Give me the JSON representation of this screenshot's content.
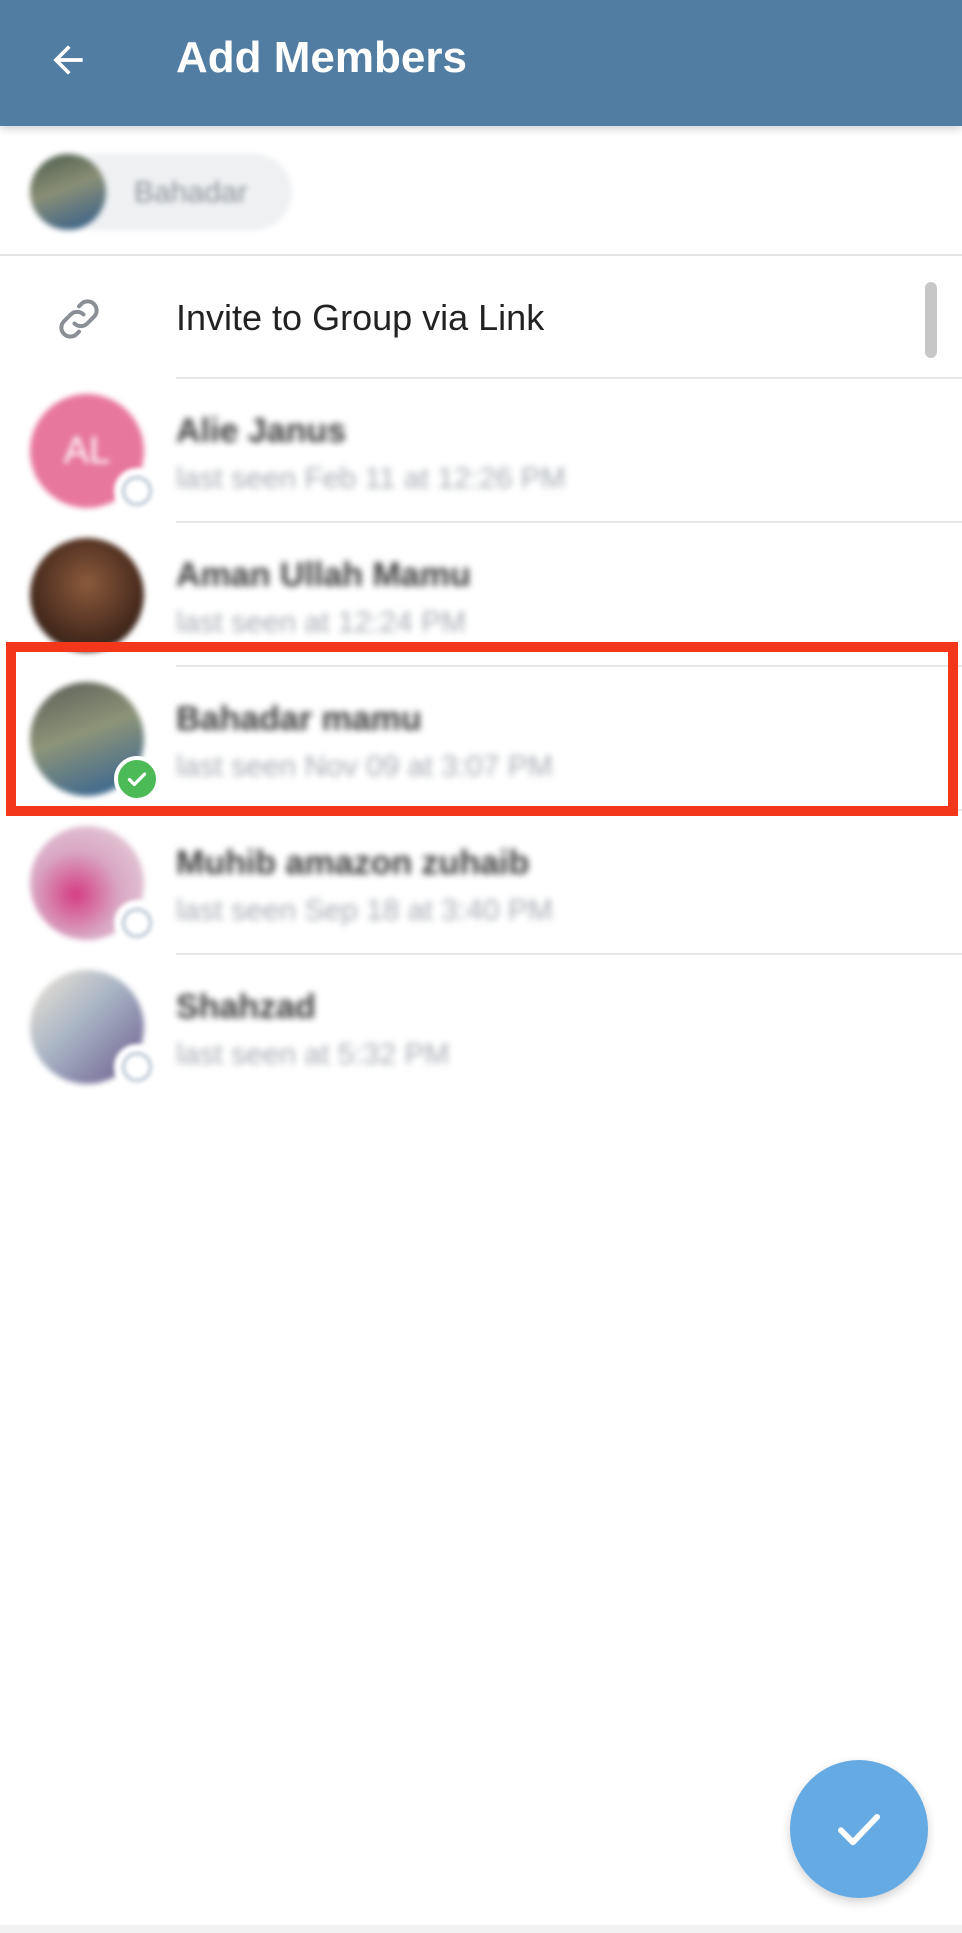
{
  "header": {
    "title": "Add Members",
    "back_icon": "arrow-back-icon",
    "background_color": "#517da2"
  },
  "chips": [
    {
      "label": "Bahadar"
    }
  ],
  "invite": {
    "label": "Invite to Group via Link",
    "icon": "link-icon"
  },
  "contacts": [
    {
      "name": "Alie Janus",
      "status": "last seen Feb 11 at 12:26 PM",
      "initials": "AL",
      "selected": false
    },
    {
      "name": "Aman Ullah Mamu",
      "status": "last seen at 12:24 PM",
      "initials": "",
      "selected": false
    },
    {
      "name": "Bahadar mamu",
      "status": "last seen Nov 09 at 3:07 PM",
      "initials": "",
      "selected": true
    },
    {
      "name": "Muhib amazon zuhaib",
      "status": "last seen Sep 18 at 3:40 PM",
      "initials": "",
      "selected": false
    },
    {
      "name": "Shahzad",
      "status": "last seen at 5:32 PM",
      "initials": "",
      "selected": false
    }
  ],
  "fab": {
    "icon": "check-icon",
    "color": "#65aae3"
  },
  "colors": {
    "selected_badge": "#4cbb57",
    "highlight_box": "#f2371a"
  }
}
